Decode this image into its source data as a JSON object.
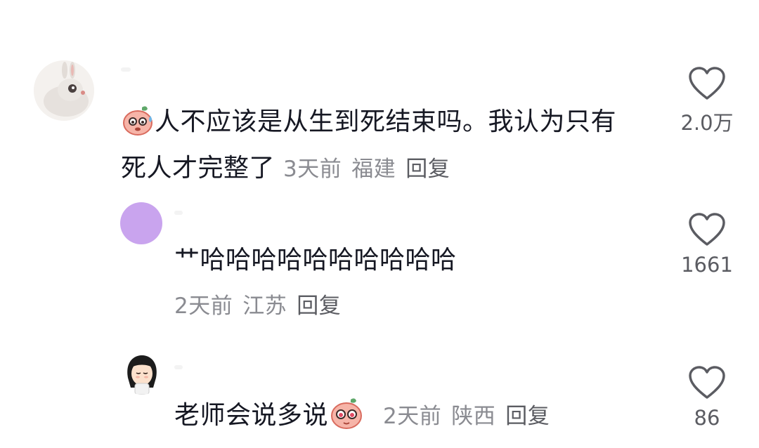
{
  "comments": [
    {
      "text": "人不应该是从生到死结束吗。我认为只有死人才完整了",
      "time": "3天前",
      "location": "福建",
      "reply_label": "回复",
      "likes": "2.0万",
      "avatar_icon": "rabbit-avatar-icon",
      "emoji_icon": "sweat-face-emoji-icon"
    },
    {
      "text": "艹哈哈哈哈哈哈哈哈哈哈",
      "time": "2天前",
      "location": "江苏",
      "reply_label": "回复",
      "likes": "1661",
      "avatar_icon": "purple-circle-avatar-icon",
      "avatar_color": "#c9a4ee"
    },
    {
      "text": "老师会说多说",
      "time": "2天前",
      "location": "陕西",
      "reply_label": "回复",
      "likes": "86",
      "avatar_icon": "girl-avatar-icon",
      "emoji_icon": "blush-face-emoji-icon"
    }
  ],
  "colors": {
    "text": "#161823",
    "meta": "#8a8b91",
    "heart_outline": "#5b5c62"
  }
}
